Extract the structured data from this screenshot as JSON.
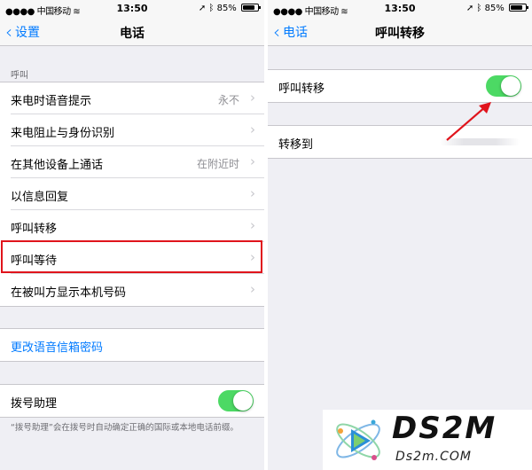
{
  "status_bar": {
    "carrier": "中国移动",
    "time": "13:50",
    "battery": "85%"
  },
  "left_screen": {
    "nav": {
      "back_label": "设置",
      "title": "电话"
    },
    "section_header": "呼叫",
    "rows": [
      {
        "label": "来电时语音提示",
        "detail": "永不"
      },
      {
        "label": "来电阻止与身份识别",
        "detail": ""
      },
      {
        "label": "在其他设备上通话",
        "detail": "在附近时"
      },
      {
        "label": "以信息回复",
        "detail": ""
      },
      {
        "label": "呼叫转移",
        "detail": ""
      },
      {
        "label": "呼叫等待",
        "detail": "",
        "highlighted": true
      },
      {
        "label": "在被叫方显示本机号码",
        "detail": ""
      }
    ],
    "voicemail_link": "更改语音信箱密码",
    "dial_assist": {
      "label": "拨号助理",
      "on": true
    },
    "dial_assist_note": "“拨号助理”会在拨号时自动确定正确的国际或本地电话前缀。"
  },
  "right_screen": {
    "nav": {
      "back_label": "电话",
      "title": "呼叫转移"
    },
    "call_forwarding": {
      "label": "呼叫转移",
      "on": true
    },
    "forward_to": {
      "label": "转移到"
    }
  },
  "colors": {
    "ios_blue": "#007aff",
    "switch_green": "#4cd964",
    "highlight_red": "#e0141c"
  },
  "watermark": {
    "brand": "DS2M",
    "domain": "Ds2m.COM"
  }
}
